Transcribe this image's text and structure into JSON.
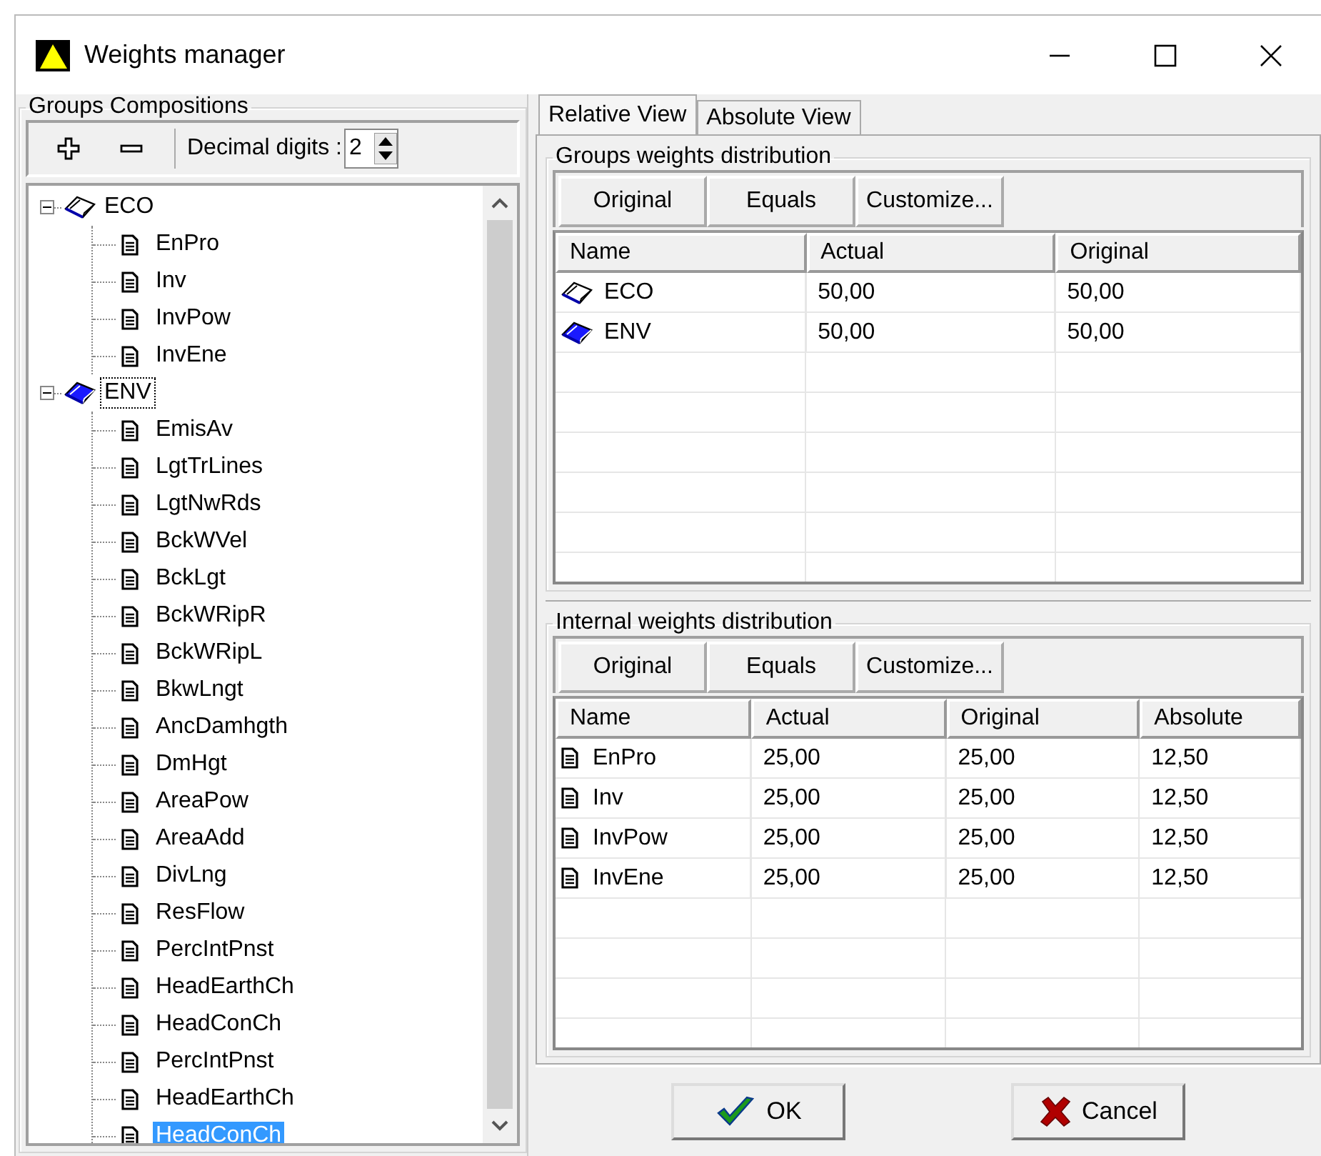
{
  "window": {
    "title": "Weights manager"
  },
  "groups_compositions": {
    "title": "Groups Compositions",
    "decimal_digits_label": "Decimal digits :",
    "decimal_digits": "2",
    "tree": [
      {
        "label": "ECO",
        "filled": false,
        "expanded": true,
        "selected": false,
        "focused": false,
        "children": [
          {
            "label": "EnPro",
            "selected": false
          },
          {
            "label": "Inv",
            "selected": false
          },
          {
            "label": "InvPow",
            "selected": false
          },
          {
            "label": "InvEne",
            "selected": false
          }
        ]
      },
      {
        "label": "ENV",
        "filled": true,
        "expanded": true,
        "selected": false,
        "focused": true,
        "children": [
          {
            "label": "EmisAv",
            "selected": false
          },
          {
            "label": "LgtTrLines",
            "selected": false
          },
          {
            "label": "LgtNwRds",
            "selected": false
          },
          {
            "label": "BckWVel",
            "selected": false
          },
          {
            "label": "BckLgt",
            "selected": false
          },
          {
            "label": "BckWRipR",
            "selected": false
          },
          {
            "label": "BckWRipL",
            "selected": false
          },
          {
            "label": "BkwLngt",
            "selected": false
          },
          {
            "label": "AncDamhgth",
            "selected": false
          },
          {
            "label": "DmHgt",
            "selected": false
          },
          {
            "label": "AreaPow",
            "selected": false
          },
          {
            "label": "AreaAdd",
            "selected": false
          },
          {
            "label": "DivLng",
            "selected": false
          },
          {
            "label": "ResFlow",
            "selected": false
          },
          {
            "label": "PercIntPnst",
            "selected": false
          },
          {
            "label": "HeadEarthCh",
            "selected": false
          },
          {
            "label": "HeadConCh",
            "selected": false
          },
          {
            "label": "PercIntPnst",
            "selected": false
          },
          {
            "label": "HeadEarthCh",
            "selected": false
          },
          {
            "label": "HeadConCh",
            "selected": true
          }
        ]
      }
    ]
  },
  "tabs": [
    {
      "label": "Relative View",
      "selected": true
    },
    {
      "label": "Absolute View",
      "selected": false
    }
  ],
  "groups_weights": {
    "title": "Groups weights distribution",
    "buttons": [
      "Original",
      "Equals",
      "Customize..."
    ],
    "columns": [
      "Name",
      "Actual",
      "Original"
    ],
    "rows": [
      {
        "name": "ECO",
        "filled": false,
        "actual": "50,00",
        "original": "50,00"
      },
      {
        "name": "ENV",
        "filled": true,
        "actual": "50,00",
        "original": "50,00"
      }
    ]
  },
  "internal_weights": {
    "title": "Internal weights distribution",
    "buttons": [
      "Original",
      "Equals",
      "Customize..."
    ],
    "columns": [
      "Name",
      "Actual",
      "Original",
      "Absolute"
    ],
    "rows": [
      {
        "name": "EnPro",
        "actual": "25,00",
        "original": "25,00",
        "absolute": "12,50"
      },
      {
        "name": "Inv",
        "actual": "25,00",
        "original": "25,00",
        "absolute": "12,50"
      },
      {
        "name": "InvPow",
        "actual": "25,00",
        "original": "25,00",
        "absolute": "12,50"
      },
      {
        "name": "InvEne",
        "actual": "25,00",
        "original": "25,00",
        "absolute": "12,50"
      }
    ]
  },
  "dialog_buttons": {
    "ok": "OK",
    "cancel": "Cancel"
  }
}
